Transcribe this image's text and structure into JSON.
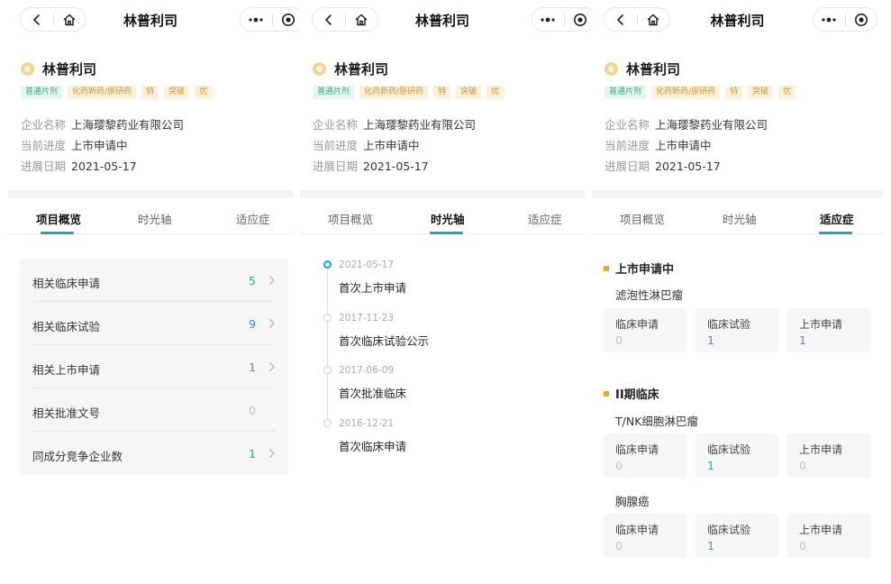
{
  "nav": {
    "title": "林普利司"
  },
  "drug": {
    "name": "林普利司",
    "tags": [
      {
        "label": "普通片剂",
        "color": "green"
      },
      {
        "label": "化药新药/原研药",
        "color": "orange"
      },
      {
        "label": "特",
        "color": "orange"
      },
      {
        "label": "突破",
        "color": "orange"
      },
      {
        "label": "优",
        "color": "orange"
      }
    ],
    "info": [
      {
        "label": "企业名称",
        "value": "上海璎黎药业有限公司"
      },
      {
        "label": "当前进度",
        "value": "上市申请中"
      },
      {
        "label": "进展日期",
        "value": "2021-05-17"
      }
    ]
  },
  "tabs": [
    "项目概览",
    "时光轴",
    "适应症"
  ],
  "overview": [
    {
      "label": "相关临床申请",
      "count": "5",
      "arrow": true
    },
    {
      "label": "相关临床试验",
      "count": "9",
      "arrow": true
    },
    {
      "label": "相关上市申请",
      "count": "1",
      "arrow": true
    },
    {
      "label": "相关批准文号",
      "count": "0",
      "arrow": false
    },
    {
      "label": "同成分竞争企业数",
      "count": "1",
      "arrow": true
    }
  ],
  "timeline": [
    {
      "date": "2021-05-17",
      "event": "首次上市申请",
      "active": true
    },
    {
      "date": "2017-11-23",
      "event": "首次临床试验公示",
      "active": false
    },
    {
      "date": "2017-06-09",
      "event": "首次批准临床",
      "active": false
    },
    {
      "date": "2016-12-21",
      "event": "首次临床申请",
      "active": false
    }
  ],
  "indications": [
    {
      "phase": "上市申请中",
      "diseases": [
        {
          "name": "滤泡性淋巴瘤",
          "stats": [
            {
              "label": "临床申请",
              "value": "0"
            },
            {
              "label": "临床试验",
              "value": "1"
            },
            {
              "label": "上市申请",
              "value": "1"
            }
          ]
        }
      ]
    },
    {
      "phase": "II期临床",
      "diseases": [
        {
          "name": "T/NK细胞淋巴瘤",
          "stats": [
            {
              "label": "临床申请",
              "value": "0"
            },
            {
              "label": "临床试验",
              "value": "1"
            },
            {
              "label": "上市申请",
              "value": "0"
            }
          ]
        },
        {
          "name": "胸腺癌",
          "stats": [
            {
              "label": "临床申请",
              "value": "0"
            },
            {
              "label": "临床试验",
              "value": "1"
            },
            {
              "label": "上市申请",
              "value": "0"
            }
          ]
        }
      ]
    }
  ],
  "icons": {
    "back": "chevron-left-icon",
    "home": "home-icon",
    "more": "more-dots-icon",
    "close": "target-circle-icon",
    "chevron": "chevron-right-icon"
  },
  "colors": {
    "accent": "#22a3c4",
    "phase": "#f0a62b"
  }
}
